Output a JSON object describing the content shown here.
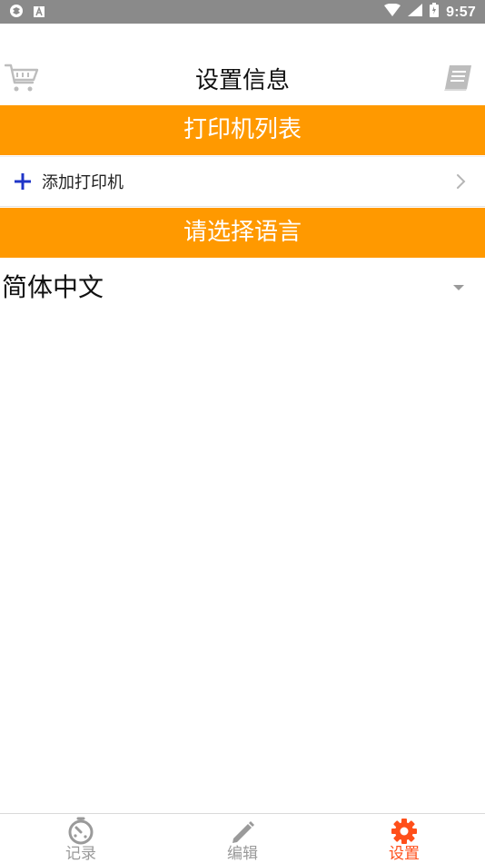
{
  "status_bar": {
    "time": "9:57",
    "left_icons": [
      "settings-badge-icon",
      "app-notification-icon"
    ],
    "right_icons": [
      "wifi-icon",
      "signal-icon",
      "battery-icon"
    ]
  },
  "header": {
    "title": "设置信息",
    "left_icon": "cart-icon",
    "right_icon": "book-icon"
  },
  "sections": {
    "printer_list": {
      "title": "打印机列表"
    },
    "language": {
      "title": "请选择语言"
    }
  },
  "add_printer": {
    "label": "添加打印机",
    "icon": "plus-icon",
    "chevron_icon": "chevron-right-icon"
  },
  "language_select": {
    "selected": "简体中文",
    "icon": "caret-down-icon"
  },
  "bottom_nav": {
    "items": [
      {
        "label": "记录",
        "icon": "timer-icon",
        "active": false
      },
      {
        "label": "编辑",
        "icon": "pencil-icon",
        "active": false
      },
      {
        "label": "设置",
        "icon": "gear-icon",
        "active": true
      }
    ]
  },
  "colors": {
    "accent_orange": "#ff9900",
    "active_nav": "#ff4f1a",
    "inactive_nav": "#9a9a9a",
    "status_bar": "#8a8a8a",
    "plus_blue": "#1f35c8"
  }
}
